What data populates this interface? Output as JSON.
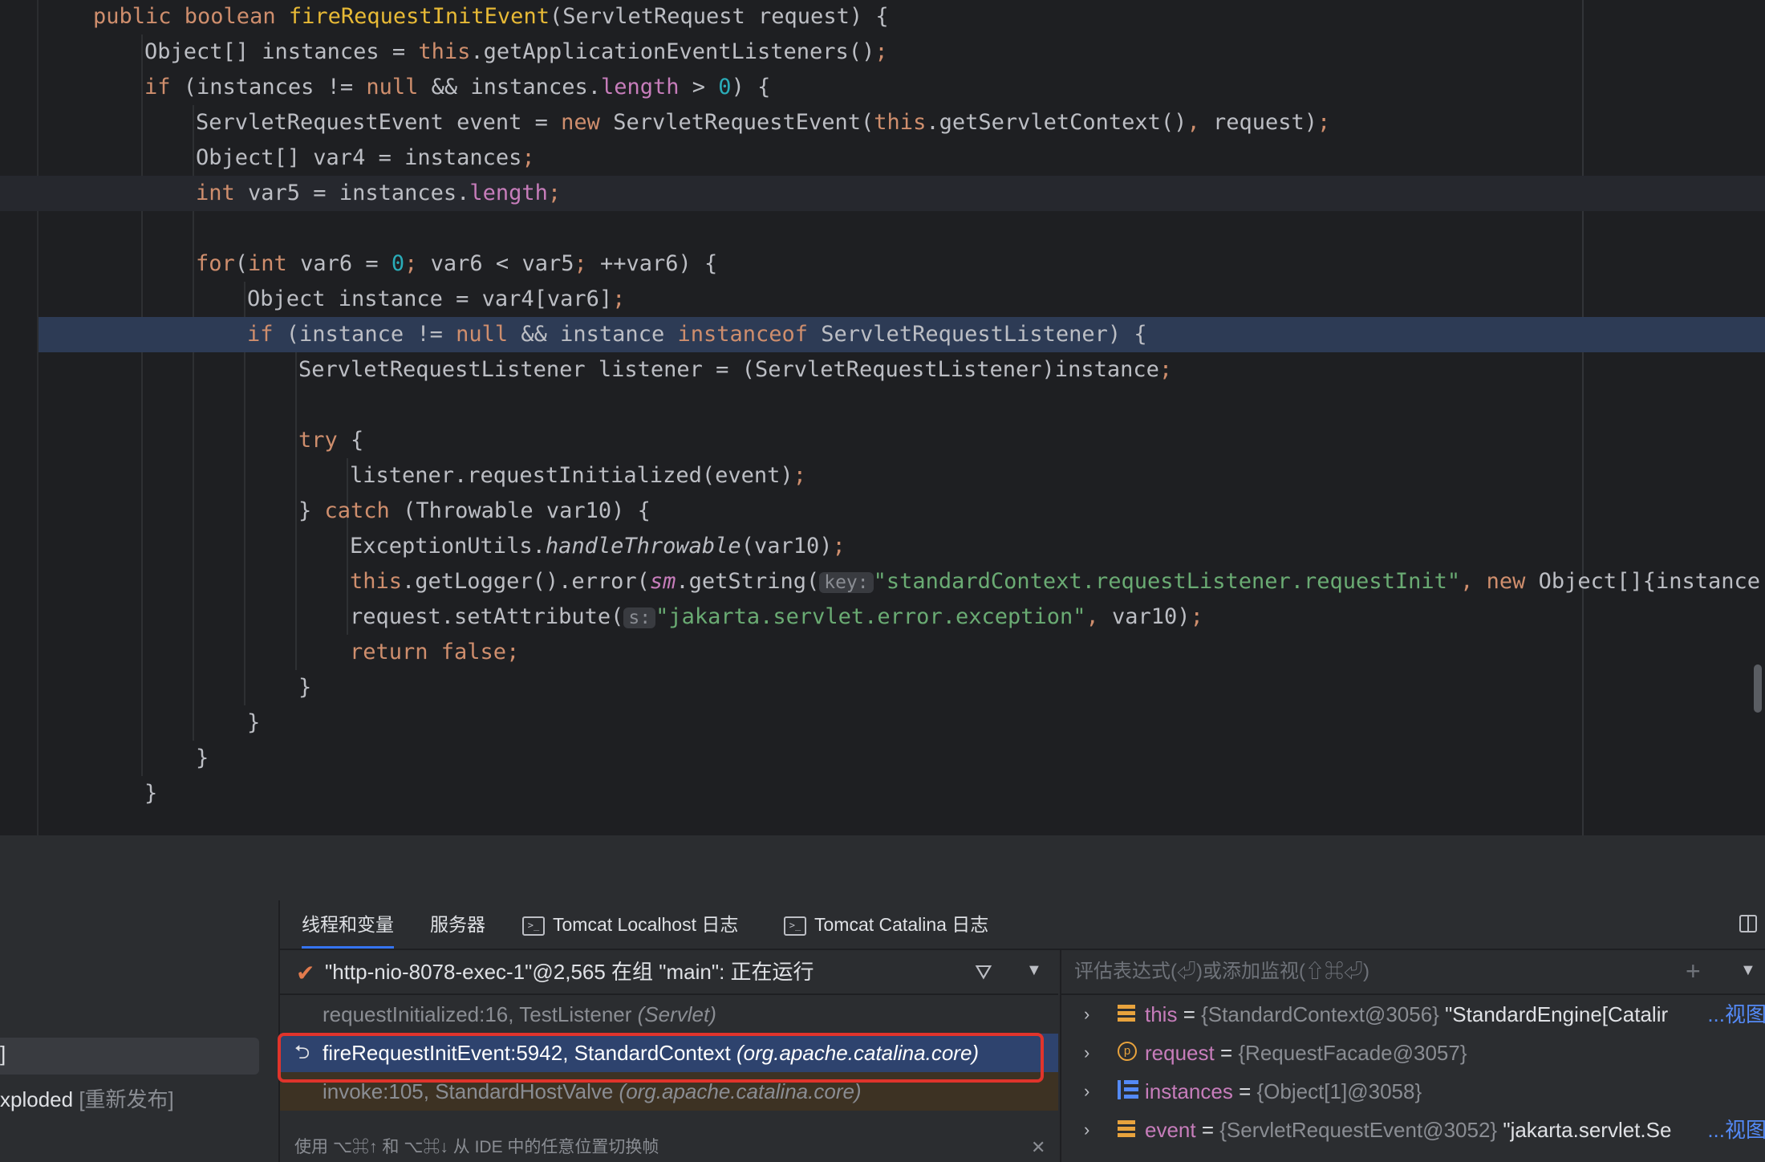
{
  "editor": {
    "lines": [
      {
        "indent": 0,
        "tokens": [
          [
            "kw",
            "public boolean "
          ],
          [
            "decl",
            "fireRequestInitEvent"
          ],
          [
            "",
            "(ServletRequest request) {"
          ]
        ]
      },
      {
        "indent": 1,
        "tokens": [
          [
            "",
            "Object[] instances = "
          ],
          [
            "kw",
            "this"
          ],
          [
            "",
            ".getApplicationEventListeners()"
          ],
          [
            "kw",
            ";"
          ]
        ]
      },
      {
        "indent": 1,
        "tokens": [
          [
            "kw",
            "if "
          ],
          [
            "",
            "(instances != "
          ],
          [
            "kw",
            "null "
          ],
          [
            "",
            "&& instances."
          ],
          [
            "field",
            "length"
          ],
          [
            "",
            " > "
          ],
          [
            "num",
            "0"
          ],
          [
            "",
            ") {"
          ]
        ]
      },
      {
        "indent": 2,
        "tokens": [
          [
            "",
            "ServletRequestEvent event = "
          ],
          [
            "kw",
            "new "
          ],
          [
            "",
            "ServletRequestEvent("
          ],
          [
            "kw",
            "this"
          ],
          [
            "",
            ".getServletContext()"
          ],
          [
            "kw",
            ", "
          ],
          [
            "",
            "request)"
          ],
          [
            "kw",
            ";"
          ]
        ]
      },
      {
        "indent": 2,
        "tokens": [
          [
            "",
            "Object[] var4 = instances"
          ],
          [
            "kw",
            ";"
          ]
        ]
      },
      {
        "indent": 2,
        "highlight": "current",
        "tokens": [
          [
            "kw",
            "int "
          ],
          [
            "",
            "var5 = instances."
          ],
          [
            "field",
            "length"
          ],
          [
            "kw",
            ";"
          ]
        ]
      },
      {
        "indent": 0,
        "tokens": []
      },
      {
        "indent": 2,
        "tokens": [
          [
            "kw",
            "for"
          ],
          [
            "",
            "("
          ],
          [
            "kw",
            "int "
          ],
          [
            "",
            "var6 = "
          ],
          [
            "num",
            "0"
          ],
          [
            "kw",
            "; "
          ],
          [
            "",
            "var6 < var5"
          ],
          [
            "kw",
            "; "
          ],
          [
            "",
            "++var6) {"
          ]
        ]
      },
      {
        "indent": 3,
        "tokens": [
          [
            "",
            "Object instance = var4[var6]"
          ],
          [
            "kw",
            ";"
          ]
        ]
      },
      {
        "indent": 3,
        "highlight": "exec",
        "tokens": [
          [
            "kw",
            "if "
          ],
          [
            "",
            "(instance != "
          ],
          [
            "kw",
            "null "
          ],
          [
            "",
            "&& instance "
          ],
          [
            "kw",
            "instanceof "
          ],
          [
            "",
            "ServletRequestListener) {"
          ]
        ]
      },
      {
        "indent": 4,
        "tokens": [
          [
            "",
            "ServletRequestListener listener = (ServletRequestListener)instance"
          ],
          [
            "kw",
            ";"
          ]
        ]
      },
      {
        "indent": 0,
        "tokens": []
      },
      {
        "indent": 4,
        "tokens": [
          [
            "kw",
            "try "
          ],
          [
            "",
            "{"
          ]
        ]
      },
      {
        "indent": 5,
        "tokens": [
          [
            "",
            "listener.requestInitialized(event)"
          ],
          [
            "kw",
            ";"
          ]
        ]
      },
      {
        "indent": 4,
        "tokens": [
          [
            "",
            "} "
          ],
          [
            "kw",
            "catch "
          ],
          [
            "",
            "(Throwable var10) {"
          ]
        ]
      },
      {
        "indent": 5,
        "tokens": [
          [
            "",
            "ExceptionUtils."
          ],
          [
            "ital",
            "handleThrowable"
          ],
          [
            "",
            "(var10)"
          ],
          [
            "kw",
            ";"
          ]
        ]
      },
      {
        "indent": 5,
        "tokens": [
          [
            "kw",
            "this"
          ],
          [
            "",
            ".getLogger().error("
          ],
          [
            "field ital",
            "sm"
          ],
          [
            "",
            ".getString("
          ],
          [
            "hint",
            "key:"
          ],
          [
            "str",
            "\"standardContext.requestListener.requestInit\""
          ],
          [
            "kw",
            ", new "
          ],
          [
            "",
            "Object[]{instance.g"
          ]
        ]
      },
      {
        "indent": 5,
        "tokens": [
          [
            "",
            "request.setAttribute("
          ],
          [
            "hint",
            "s:"
          ],
          [
            "str",
            "\"jakarta.servlet.error.exception\""
          ],
          [
            "kw",
            ", "
          ],
          [
            "",
            "var10)"
          ],
          [
            "kw",
            ";"
          ]
        ]
      },
      {
        "indent": 5,
        "tokens": [
          [
            "kw",
            "return false;"
          ]
        ]
      },
      {
        "indent": 4,
        "tokens": [
          [
            "",
            "}"
          ]
        ]
      },
      {
        "indent": 3,
        "tokens": [
          [
            "",
            "}"
          ]
        ]
      },
      {
        "indent": 2,
        "tokens": [
          [
            "",
            "}"
          ]
        ]
      },
      {
        "indent": 1,
        "tokens": [
          [
            "",
            "}"
          ]
        ]
      }
    ]
  },
  "left_panel": {
    "bracket": "]",
    "deploy_name": "xploded",
    "deploy_action": "[重新发布]"
  },
  "tabs": {
    "threads_vars": "线程和变量",
    "server": "服务器",
    "tomcat_localhost": "Tomcat Localhost 日志",
    "tomcat_catalina": "Tomcat Catalina 日志"
  },
  "thread": {
    "label": "\"http-nio-8078-exec-1\"@2,565 在组 \"main\": 正在运行"
  },
  "frames": [
    {
      "method": "requestInitialized:16, TestListener",
      "pkg": "(Servlet)",
      "state": "dim"
    },
    {
      "method": "fireRequestInitEvent:5942, StandardContext",
      "pkg": "(org.apache.catalina.core)",
      "state": "selected"
    },
    {
      "method": "invoke:105, StandardHostValve",
      "pkg": "(org.apache.catalina.core)",
      "state": "library"
    }
  ],
  "frames_footer": "使用 ⌥⌘↑ 和 ⌥⌘↓ 从 IDE 中的任意位置切换帧",
  "eval": {
    "placeholder": "评估表达式(⏎)或添加监视(⇧⌘⏎)"
  },
  "variables": [
    {
      "icon": "field-icon",
      "name": "this",
      "obj": "{StandardContext@3056}",
      "str": "\"StandardEngine[Catalir",
      "link": "...视图"
    },
    {
      "icon": "param-icon",
      "name": "request",
      "obj": "{RequestFacade@3057}",
      "str": "",
      "link": ""
    },
    {
      "icon": "array-icon",
      "name": "instances",
      "obj": "{Object[1]@3058}",
      "str": "",
      "link": ""
    },
    {
      "icon": "field-icon",
      "name": "event",
      "obj": "{ServletRequestEvent@3052}",
      "str": "\"jakarta.servlet.Se",
      "link": "...视图"
    }
  ],
  "equals": " = "
}
